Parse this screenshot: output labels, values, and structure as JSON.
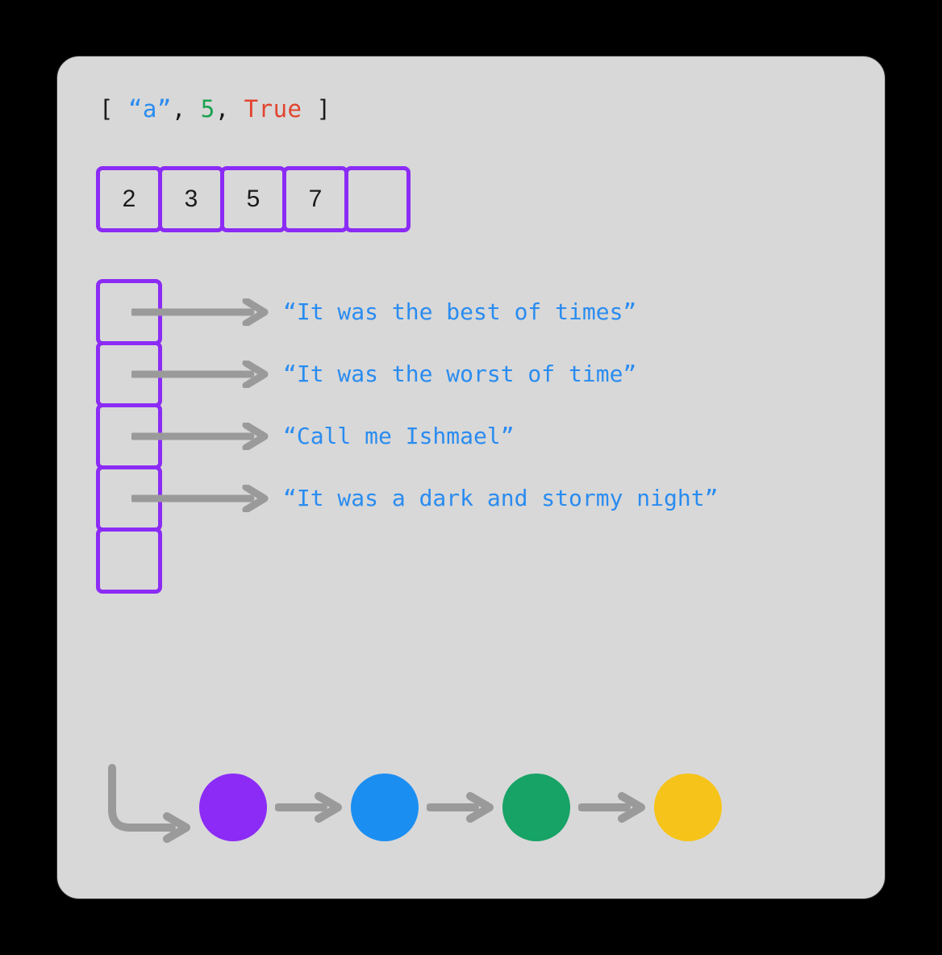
{
  "literal": {
    "open": "[",
    "close": "]",
    "comma": ",",
    "string_token": "“a”",
    "number_token": "5",
    "bool_token": "True"
  },
  "horizontal_array": [
    "2",
    "3",
    "5",
    "7",
    ""
  ],
  "vertical_array": {
    "cell_count": 5,
    "pointers": [
      "“It was the best of times”",
      "“It was the worst of time”",
      "“Call me Ishmael”",
      "“It was a dark and stormy night”"
    ]
  },
  "linked_list": {
    "node_colors": [
      "#8b2bf5",
      "#1b8ef2",
      "#16a365",
      "#f6c31a"
    ]
  },
  "colors": {
    "cell_border": "#8b2bf5",
    "arrow": "#9a9a9a",
    "string": "#2a8cf0",
    "number": "#1aa251",
    "boolean": "#e2442f",
    "panel_bg": "#d8d8d8"
  }
}
